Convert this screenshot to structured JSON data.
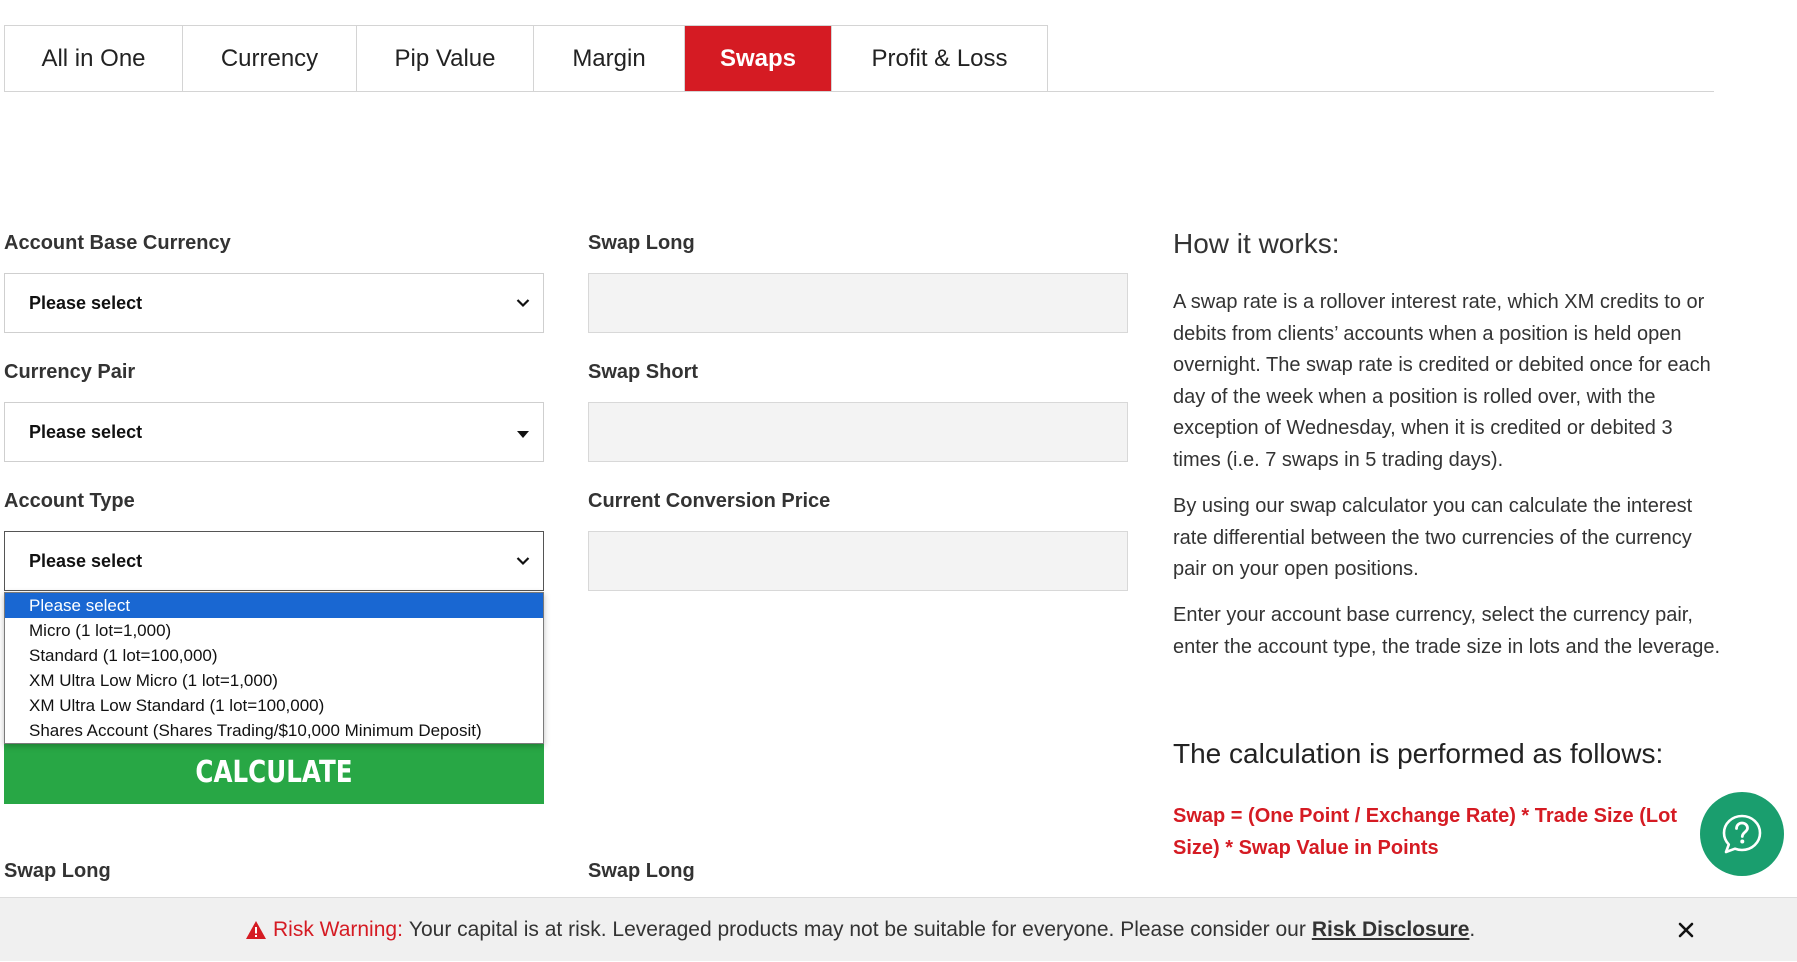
{
  "tabs": [
    {
      "label": "All in One",
      "active": false
    },
    {
      "label": "Currency",
      "active": false
    },
    {
      "label": "Pip Value",
      "active": false
    },
    {
      "label": "Margin",
      "active": false
    },
    {
      "label": "Swaps",
      "active": true
    },
    {
      "label": "Profit & Loss",
      "active": false
    }
  ],
  "form": {
    "account_base_currency": {
      "label": "Account Base Currency",
      "value": "Please select"
    },
    "currency_pair": {
      "label": "Currency Pair",
      "value": "Please select"
    },
    "account_type": {
      "label": "Account Type",
      "value": "Please select",
      "options": [
        "Please select",
        "Micro (1 lot=1,000)",
        "Standard (1 lot=100,000)",
        "XM Ultra Low Micro (1 lot=1,000)",
        "XM Ultra Low Standard (1 lot=100,000)",
        "Shares Account (Shares Trading/$10,000 Minimum Deposit)"
      ],
      "selected_index": 0
    },
    "swap_long": {
      "label": "Swap Long"
    },
    "swap_short": {
      "label": "Swap Short"
    },
    "conversion_price": {
      "label": "Current Conversion Price"
    },
    "calculate_label": "CALCULATE"
  },
  "results": {
    "left_label": "Swap Long",
    "right_label": "Swap Long"
  },
  "how_it_works": {
    "title": "How it works:",
    "paragraphs": [
      "A swap rate is a rollover interest rate, which XM credits to or debits from clients’ accounts when a position is held open overnight. The swap rate is credited or debited once for each day of the week when a position is rolled over, with the exception of Wednesday, when it is credited or debited 3 times (i.e. 7 swaps in 5 trading days).",
      "By using our swap calculator you can calculate the interest rate differential between the two currencies of the currency pair on your open positions.",
      "Enter your account base currency, select the currency pair, enter the account type, the trade size in lots and the leverage."
    ],
    "calc_title": "The calculation is performed as follows:",
    "formula": "Swap = (One Point / Exchange Rate) * Trade Size (Lot Size) * Swap Value in Points"
  },
  "risk_bar": {
    "label": "Risk Warning:",
    "text": "Your capital is at risk. Leveraged products may not be suitable for everyone. Please consider our",
    "link": "Risk Disclosure",
    "period": "."
  },
  "colors": {
    "brand_red": "#d51b23",
    "calculate_green": "#28a745",
    "help_green": "#1a9e6e",
    "dropdown_highlight": "#1967d2"
  },
  "icons": {
    "select_arrow": "chevron-down-icon",
    "help": "question-bubble-icon",
    "warning": "warning-triangle-icon",
    "close": "close-icon"
  }
}
